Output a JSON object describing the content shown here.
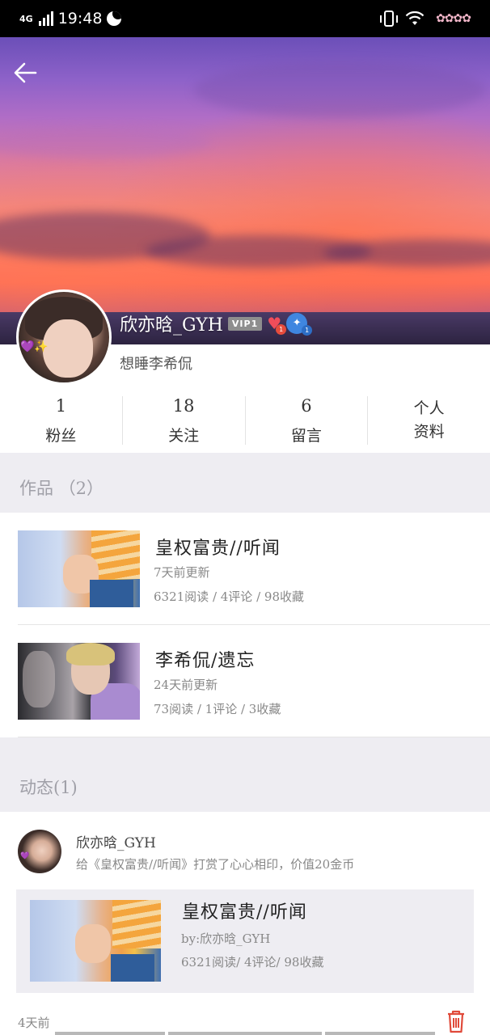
{
  "status_bar": {
    "network": "4G",
    "time": "19:48"
  },
  "profile": {
    "username": "欣亦晗_GYH",
    "vip": "VIP1",
    "heart_badge_count": "1",
    "blue_badge_count": "1",
    "signature": "想睡李希侃"
  },
  "stats": {
    "fans_count": "1",
    "fans_label": "粉丝",
    "follow_count": "18",
    "follow_label": "关注",
    "message_count": "6",
    "message_label": "留言",
    "profile_line1": "个人",
    "profile_line2": "资料"
  },
  "works": {
    "header": "作品 （2）",
    "items": [
      {
        "title": "皇权富贵//听闻",
        "updated": "7天前更新",
        "stats": "6321阅读 / 4评论 / 98收藏"
      },
      {
        "title": "李希侃/遗忘",
        "updated": "24天前更新",
        "stats": "73阅读 / 1评论 / 3收藏"
      }
    ]
  },
  "feed": {
    "header": "动态(1)",
    "name": "欣亦晗_GYH",
    "text": "给《皇权富贵//听闻》打赏了心心相印，价值20金币",
    "card": {
      "title": "皇权富贵//听闻",
      "by": "by:欣亦晗_GYH",
      "stats": "6321阅读/ 4评论/ 98收藏"
    },
    "time": "4天前"
  },
  "colors": {
    "section_bg": "#eeedf2",
    "accent_red": "#e74c3c",
    "text_gray": "#888888"
  }
}
